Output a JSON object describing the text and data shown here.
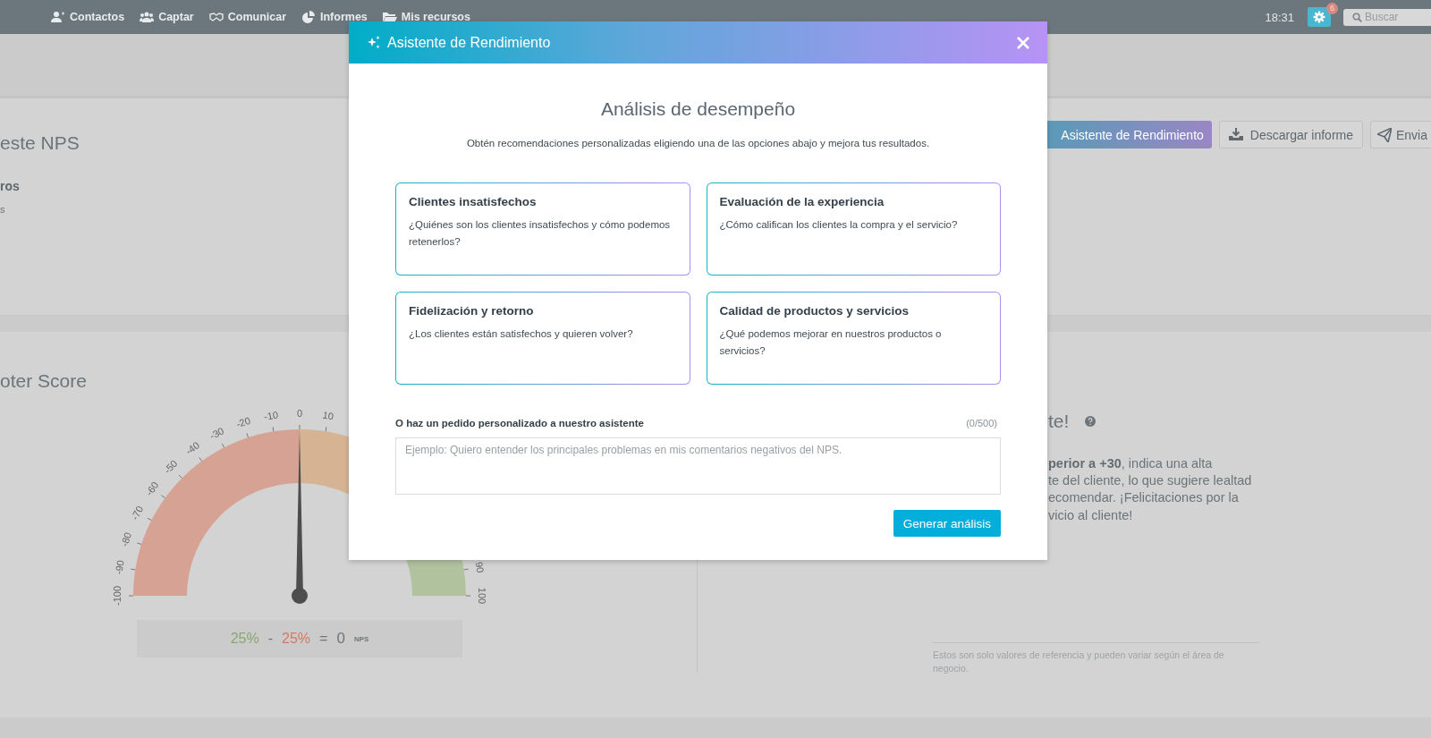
{
  "nav": {
    "items": [
      {
        "label": "Contactos",
        "kind": "person"
      },
      {
        "label": "Captar",
        "kind": "group"
      },
      {
        "label": "Comunicar",
        "kind": "handshake"
      },
      {
        "label": "Informes",
        "kind": "pie"
      },
      {
        "label": "Mis recursos",
        "kind": "folder"
      }
    ],
    "time": "18:31",
    "notifications": "6",
    "search": {
      "placeholder": "Buscar"
    }
  },
  "report": {
    "title": "este NPS",
    "subtitle": "ros",
    "caption": "s",
    "buttons": [
      {
        "label": "Asistente de Rendimiento",
        "kind": "assistant"
      },
      {
        "label": "Descargar informe",
        "kind": "download"
      },
      {
        "label": "Envia",
        "kind": "send"
      }
    ]
  },
  "score_panel": {
    "title": "oter Score",
    "gauge": {
      "ticks": [
        "-100",
        "-90",
        "-80",
        "-70",
        "-60",
        "-50",
        "-40",
        "-30",
        "-20",
        "-10",
        "0",
        "10",
        "90",
        "100"
      ],
      "level": 0.5
    },
    "formula": {
      "promoters": "25%",
      "minus": "-",
      "detractors": "25%",
      "equals": "=",
      "value": "0",
      "unit": "NPS"
    }
  },
  "result_panel": {
    "title": "te!",
    "lines": [
      "**perior a +30**, indica una alta",
      "te del cliente, lo que sugiere lealtad",
      "ecomendar. ¡Felicitaciones por la",
      "vicio al cliente!"
    ],
    "footnote": "Estos son solo valores de referencia y pueden variar según el área de negocio."
  },
  "modal": {
    "title": "Asistente de Rendimiento",
    "heading": "Análisis de desempeño",
    "intro": "Obtén recomendaciones personalizadas eligiendo una de las opciones abajo y mejora tus resultados.",
    "options": [
      {
        "title": "Clientes insatisfechos",
        "text": "¿Quiénes son los clientes insatisfechos y cómo podemos retenerlos?"
      },
      {
        "title": "Evaluación de la experiencia",
        "text": "¿Cómo califican los clientes la compra y el servicio?"
      },
      {
        "title": "Fidelización y retorno",
        "text": "¿Los clientes están satisfechos y quieren volver?"
      },
      {
        "title": "Calidad de productos y servicios",
        "text": "¿Qué podemos mejorar en nuestros productos o servicios?"
      }
    ],
    "custom_label": "O haz un pedido personalizado a nuestro asistente",
    "counter": "(0/500)",
    "placeholder": "Ejemplo: Quiero entender los principales problemas en mis comentarios negativos del NPS.",
    "submit": "Generar análisis"
  }
}
